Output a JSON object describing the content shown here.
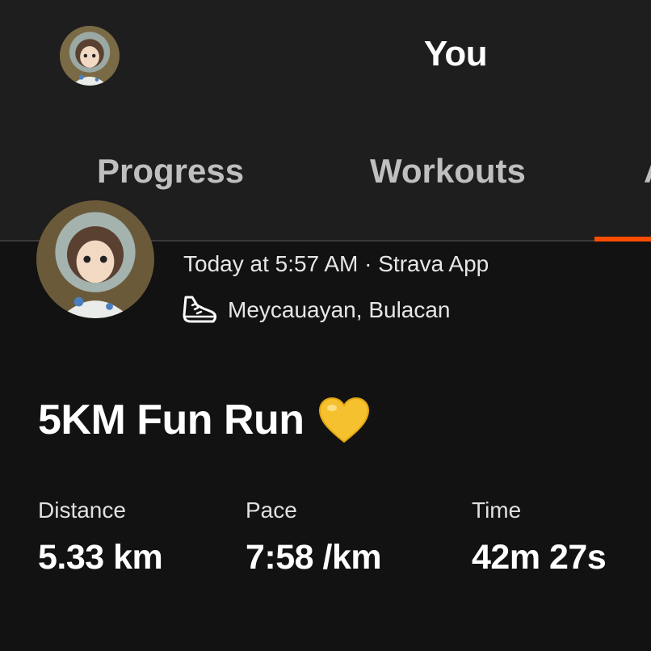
{
  "header": {
    "title": "You",
    "avatar_icon": "profile-avatar-icon"
  },
  "tabs": [
    {
      "label": "Progress",
      "active": false
    },
    {
      "label": "Workouts",
      "active": false
    },
    {
      "label": "A",
      "active": true
    }
  ],
  "colors": {
    "accent": "#fc4c02",
    "background": "#121212",
    "header_background": "#1e1e1e"
  },
  "activity": {
    "meta": "Today at 5:57 AM · Strava App",
    "location_icon": "running-shoe-icon",
    "location": "Meycauayan, Bulacan",
    "title": "5KM Fun Run",
    "title_icon": "yellow-heart-icon",
    "stats": [
      {
        "label": "Distance",
        "value": "5.33 km"
      },
      {
        "label": "Pace",
        "value": "7:58 /km"
      },
      {
        "label": "Time",
        "value": "42m 27s"
      }
    ]
  }
}
